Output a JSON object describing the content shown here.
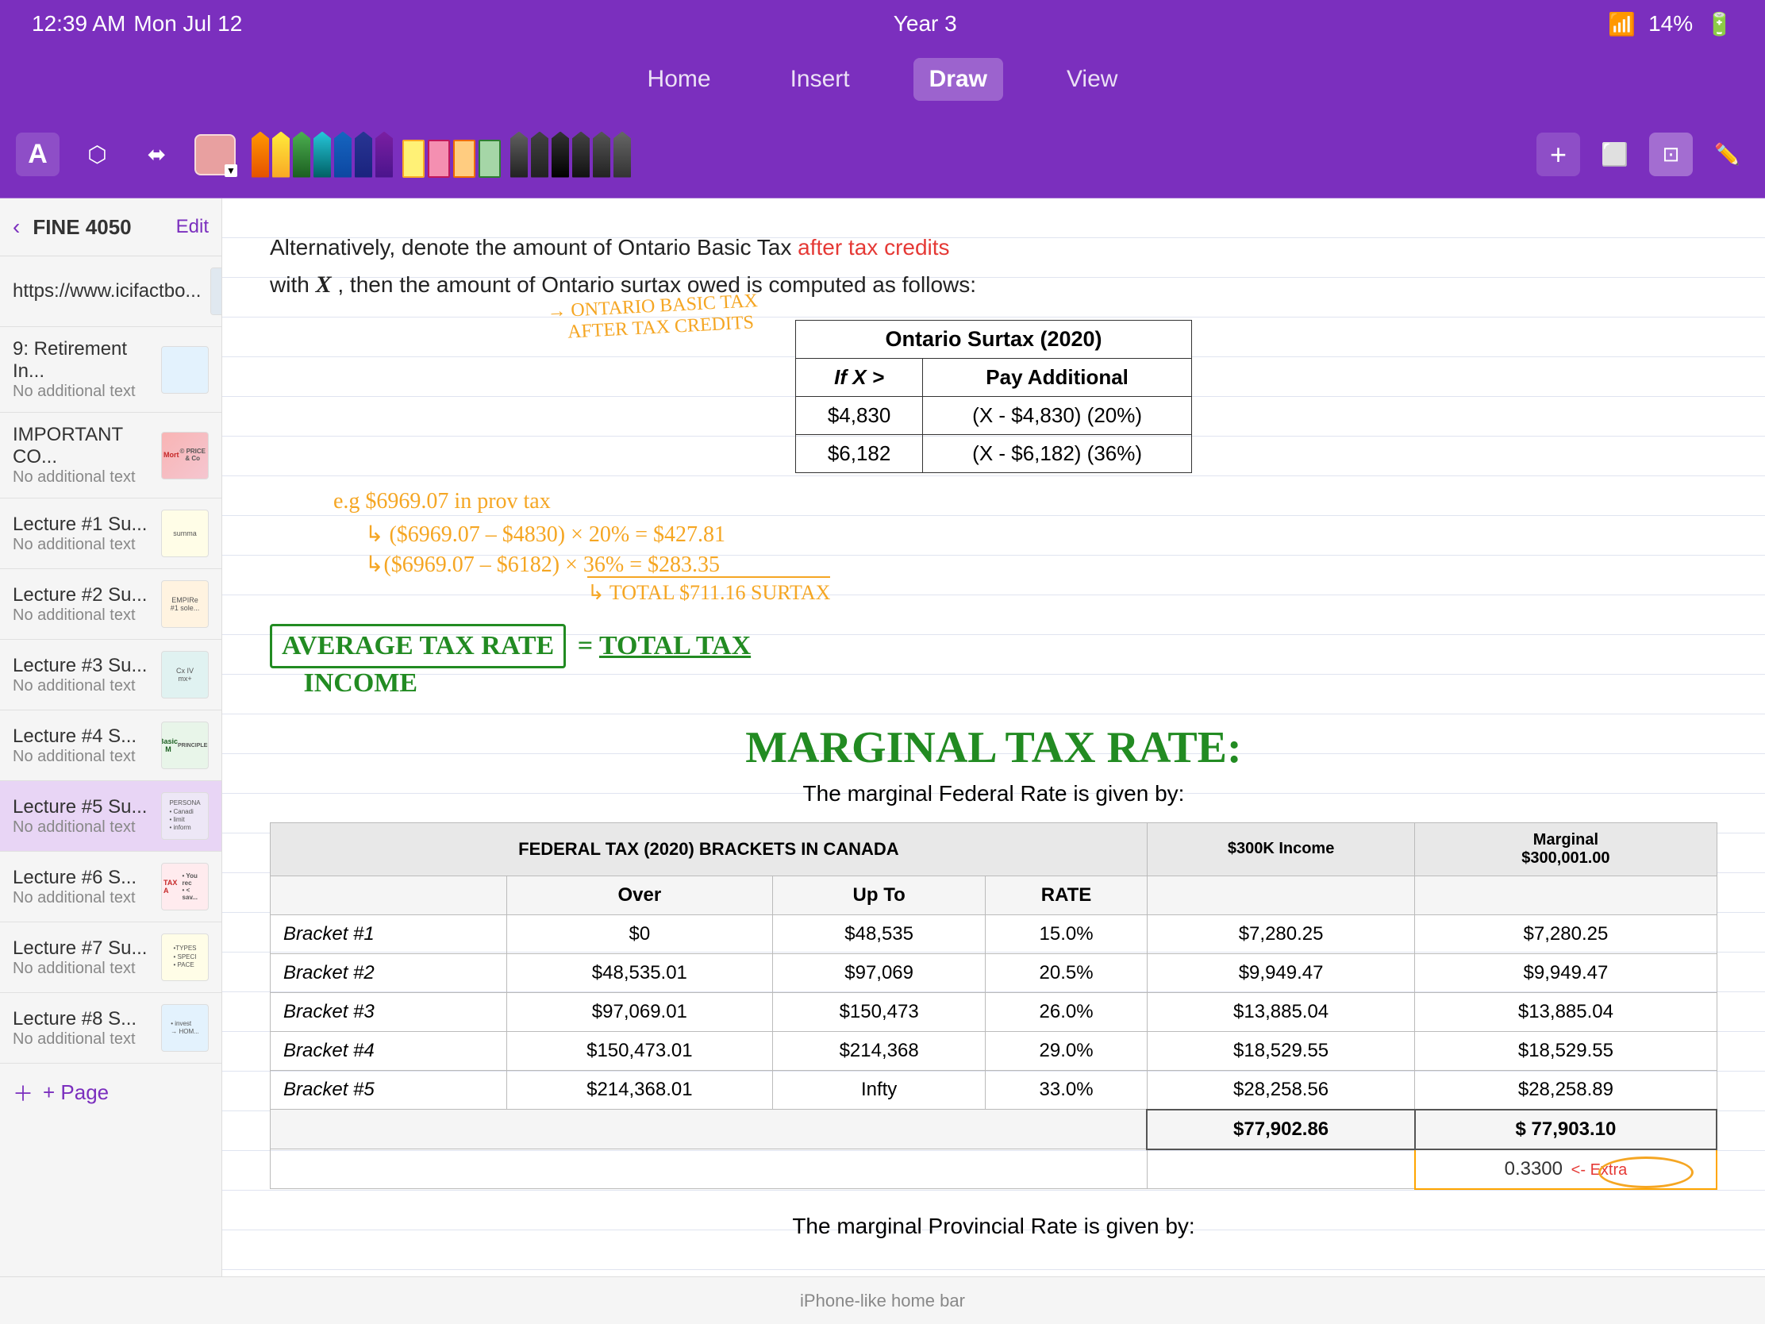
{
  "statusBar": {
    "time": "12:39 AM",
    "day": "Mon Jul 12",
    "title": "Year 3",
    "wifi": "WiFi",
    "battery": "14%"
  },
  "toolbar": {
    "tools": [
      "A",
      "lasso",
      "move",
      "eraser"
    ],
    "colorSwatch": "#e8a0a0",
    "addIcon": "+",
    "moreIcons": [
      "layers",
      "select",
      "pen"
    ]
  },
  "navTabs": {
    "items": [
      "Home",
      "Insert",
      "Draw",
      "View"
    ],
    "active": "Draw"
  },
  "sidebar": {
    "title": "FINE 4050",
    "editLabel": "Edit",
    "items": [
      {
        "name": "https://www.icifactbo...",
        "sub": "",
        "thumbType": "url"
      },
      {
        "name": "9: Retirement In...",
        "sub": "No additional text",
        "thumbType": "blue"
      },
      {
        "name": "IMPORTANT CO...",
        "sub": "No additional text",
        "thumbType": "pink",
        "thumbText": "MART"
      },
      {
        "name": "Lecture #1 Su...",
        "sub": "No additional text",
        "thumbType": "yellow",
        "thumbText": "summa"
      },
      {
        "name": "Lecture #2 Su...",
        "sub": "No additional text",
        "thumbType": "orange",
        "thumbText": "EMPIRe"
      },
      {
        "name": "Lecture #3 Su...",
        "sub": "No additional text",
        "thumbType": "teal",
        "thumbText": "Cx IV"
      },
      {
        "name": "Lecture #4 S...",
        "sub": "No additional text",
        "thumbType": "green",
        "thumbText": "Basic M"
      },
      {
        "name": "Lecture #5 Su...",
        "sub": "No additional text",
        "thumbType": "lavender",
        "thumbText": "PERSONA",
        "active": true
      },
      {
        "name": "Lecture #6 S...",
        "sub": "No additional text",
        "thumbType": "red",
        "thumbText": "TAX A"
      },
      {
        "name": "Lecture #7 Su...",
        "sub": "No additional text",
        "thumbType": "yellow",
        "thumbText": "TYPES"
      },
      {
        "name": "Lecture #8 S...",
        "sub": "No additional text",
        "thumbType": "blue",
        "thumbText": "invest"
      }
    ],
    "addPage": "+ Page"
  },
  "content": {
    "introText": "Alternatively, denote the amount of Ontario Basic Tax",
    "highlightText": "after tax credits",
    "introText2": "with",
    "italicX": "X",
    "introText3": ", then the amount of Ontario surtax owed is computed as follows:",
    "ontarioAnnotation": "→ ONTARIO BASIC TAX\n   AFTER TAX CREDITS",
    "surtaxTitle": "Ontario Surtax (2020)",
    "surtaxHeaders": [
      "If X >",
      "Pay Additional"
    ],
    "surtaxRows": [
      {
        "ifX": "$4,830",
        "pay": "(X - $4,830) (20%)"
      },
      {
        "ifX": "$6,182",
        "pay": "(X - $6,182) (36%)"
      }
    ],
    "calcLine1": "e.g  $6969.07 in prov tax",
    "calcLine2": "↳ ($6969.07 – $4830) × 20% = $427.81",
    "calcLine3": "↳($6969.07 – $6182) × 36% = $283.35",
    "calcLine4": "↳ TOTAL $711.16 SURTAX",
    "avgRateLabel": "AVERAGE TAX RATE",
    "avgRateEq": "= TOTAL TAX / INCOME",
    "marginalTitle": "MARGINAL TAX RATE:",
    "marginalSubtitle": "The marginal Federal Rate is given by:",
    "federalTableTitle": "FEDERAL TAX (2020) BRACKETS IN CANADA",
    "federalHeaders": [
      "",
      "Over",
      "Up To",
      "RATE",
      "$300K Income",
      "Marginal $300,001.00"
    ],
    "federalRows": [
      {
        "bracket": "Bracket #1",
        "over": "$0",
        "upto": "$48,535",
        "rate": "15.0%",
        "income300k": "$7,280.25",
        "marginal": "$7,280.25"
      },
      {
        "bracket": "Bracket #2",
        "over": "$48,535.01",
        "upto": "$97,069",
        "rate": "20.5%",
        "income300k": "$9,949.47",
        "marginal": "$9,949.47"
      },
      {
        "bracket": "Bracket #3",
        "over": "$97,069.01",
        "upto": "$150,473",
        "rate": "26.0%",
        "income300k": "$13,885.04",
        "marginal": "$13,885.04"
      },
      {
        "bracket": "Bracket #4",
        "over": "$150,473.01",
        "upto": "$214,368",
        "rate": "29.0%",
        "income300k": "$18,529.55",
        "marginal": "$18,529.55"
      },
      {
        "bracket": "Bracket #5",
        "over": "$214,368.01",
        "upto": "Infty",
        "rate": "33.0%",
        "income300k": "$28,258.56",
        "marginal": "$28,258.89"
      }
    ],
    "federalTotal": "$77,902.86",
    "federalMarginalTotal": "$ 77,903.10",
    "federalExtraRate": "0.3300",
    "federalExtraLabel": "<- Extra",
    "provText": "The marginal Provincial Rate is given by:"
  }
}
